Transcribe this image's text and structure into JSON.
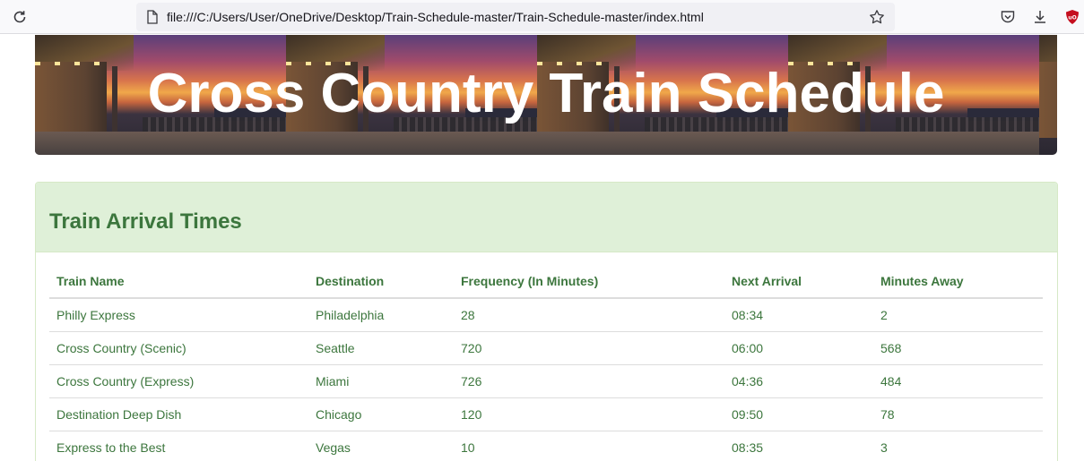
{
  "browser": {
    "url": "file:///C:/Users/User/OneDrive/Desktop/Train-Schedule-master/Train-Schedule-master/index.html",
    "icons": [
      "reload-icon",
      "page-icon",
      "bookmark-star-icon",
      "pocket-icon",
      "download-icon",
      "ublock-origin-icon"
    ]
  },
  "banner": {
    "title": "Cross Country Train Schedule"
  },
  "panel": {
    "title": "Train Arrival Times",
    "columns": [
      "Train Name",
      "Destination",
      "Frequency (In Minutes)",
      "Next Arrival",
      "Minutes Away"
    ],
    "rows": [
      [
        "Philly Express",
        "Philadelphia",
        "28",
        "08:34",
        "2"
      ],
      [
        "Cross Country (Scenic)",
        "Seattle",
        "720",
        "06:00",
        "568"
      ],
      [
        "Cross Country (Express)",
        "Miami",
        "726",
        "04:36",
        "484"
      ],
      [
        "Destination Deep Dish",
        "Chicago",
        "120",
        "09:50",
        "78"
      ],
      [
        "Express to the Best",
        "Vegas",
        "10",
        "08:35",
        "3"
      ]
    ]
  },
  "colors": {
    "panel_heading_bg": "#dff0d8",
    "panel_text": "#3c763d",
    "panel_border": "#d6e9c6",
    "ublock_red": "#c50f1f"
  }
}
